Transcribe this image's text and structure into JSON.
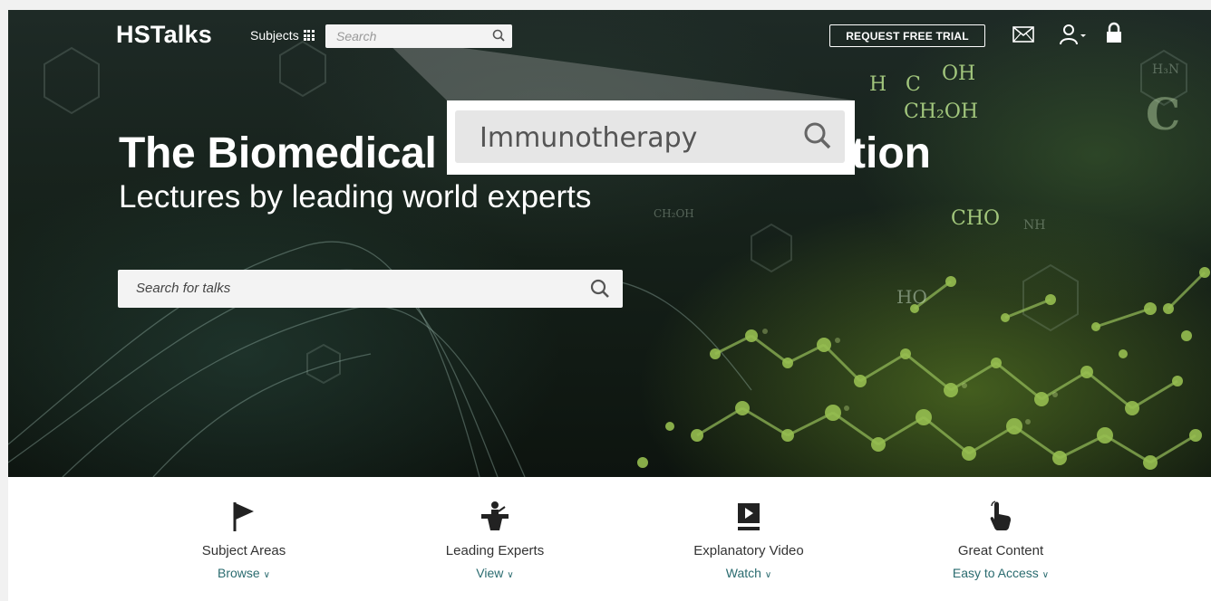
{
  "header": {
    "logo": "HSTalks",
    "subjects_label": "Subjects",
    "search_placeholder": "Search",
    "trial_button": "REQUEST FREE TRIAL",
    "icons": [
      "mail-icon",
      "user-icon",
      "lock-icon",
      "grid-icon",
      "search-icon"
    ]
  },
  "callout": {
    "query": "Immunotherapy"
  },
  "hero": {
    "title_start": "The Biomedical",
    "title_end": "tion",
    "subtitle": "Lectures by leading world experts",
    "search_placeholder": "Search for talks",
    "formulas": [
      "H",
      "C",
      "OH",
      "CH₂OH",
      "CHO",
      "NH",
      "H₃N",
      "C",
      "HO",
      "CH₂OH"
    ]
  },
  "features": [
    {
      "label": "Subject Areas",
      "link": "Browse",
      "icon": "flag-icon"
    },
    {
      "label": "Leading Experts",
      "link": "View",
      "icon": "lectern-icon"
    },
    {
      "label": "Explanatory Video",
      "link": "Watch",
      "icon": "video-icon"
    },
    {
      "label": "Great Content",
      "link": "Easy to Access",
      "icon": "pointer-hand-icon"
    }
  ],
  "colors": {
    "link": "#2a6b6f",
    "hero_dark": "#152019",
    "molecule_green": "#8fb04a"
  }
}
